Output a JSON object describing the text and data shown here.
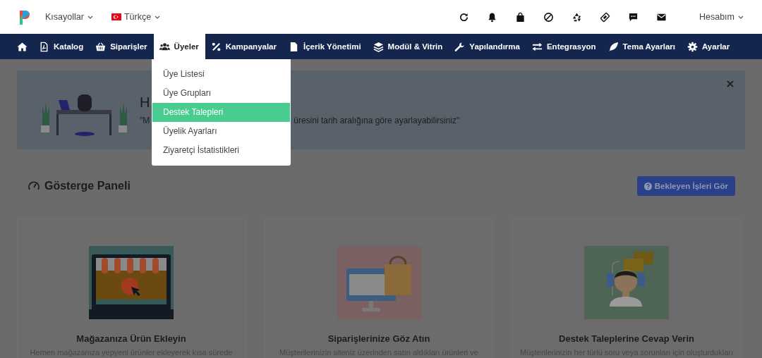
{
  "topbar": {
    "shortcuts": "Kısayollar",
    "language": "Türkçe",
    "account": "Hesabım"
  },
  "nav": [
    {
      "label": "Katalog",
      "selected": false
    },
    {
      "label": "Siparişler",
      "selected": false
    },
    {
      "label": "Üyeler",
      "selected": true
    },
    {
      "label": "Kampanyalar",
      "selected": false
    },
    {
      "label": "İçerik Yönetimi",
      "selected": false
    },
    {
      "label": "Modül & Vitrin",
      "selected": false
    },
    {
      "label": "Yapılandırma",
      "selected": false
    },
    {
      "label": "Entegrasyon",
      "selected": false
    },
    {
      "label": "Tema Ayarları",
      "selected": false
    },
    {
      "label": "Ayarlar",
      "selected": false
    }
  ],
  "dropdown": [
    {
      "label": "Üye Listesi",
      "selected": false
    },
    {
      "label": "Üye Grupları",
      "selected": false
    },
    {
      "label": "Destek Talepleri",
      "selected": true
    },
    {
      "label": "Üyelik Ayarları",
      "selected": false
    },
    {
      "label": "Ziyaretçi İstatistikleri",
      "selected": false
    }
  ],
  "banner": {
    "title": "H",
    "text_start": "\"M",
    "text_end": "üresini tarih aralığına göre ayarlayabilirsiniz\""
  },
  "dashboard": {
    "title": "Gösterge Paneli",
    "button": "Bekleyen İşleri Gör"
  },
  "cards": [
    {
      "title": "Mağazanıza Ürün Ekleyin",
      "text": "Hemen mağazanıza yepyeni ürünler ekleyerek kısa sürede"
    },
    {
      "title": "Siparişlerinize Göz Atın",
      "text": "Müşterilerinizin siteniz üzerinden satın aldıkları ürünleri ve"
    },
    {
      "title": "Destek Taleplerine Cevap Verin",
      "text": "Müşterilerinizin her türlü soru veya sorunları için oluşturdukları"
    }
  ]
}
